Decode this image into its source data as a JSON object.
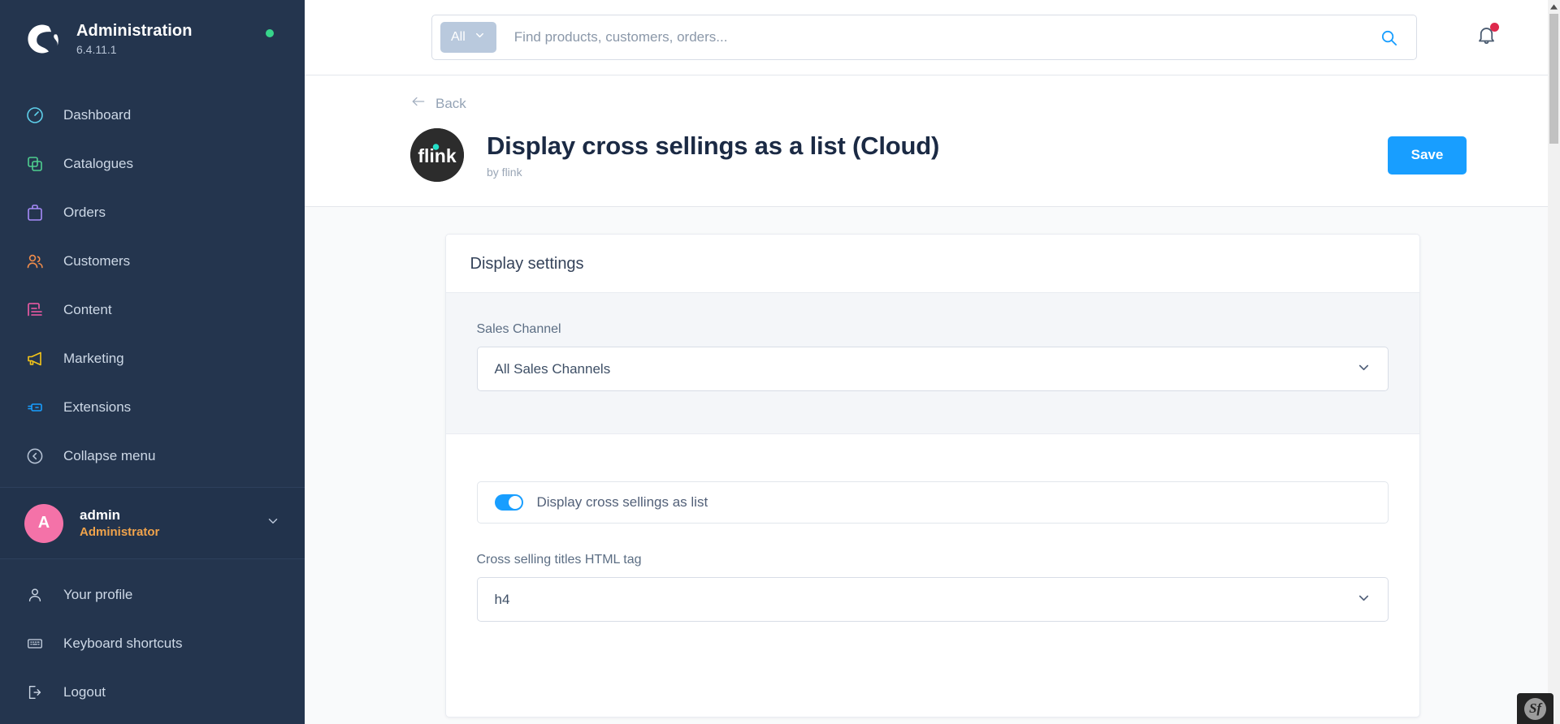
{
  "sidebar": {
    "brand": {
      "title": "Administration",
      "version": "6.4.11.1",
      "logo_icon": "shopware-logo-icon",
      "status_icon": "status-online-dot"
    },
    "items": [
      {
        "label": "Dashboard",
        "icon": "dashboard-icon",
        "color": "#5ecfea"
      },
      {
        "label": "Catalogues",
        "icon": "catalogues-icon",
        "color": "#4ecf8f"
      },
      {
        "label": "Orders",
        "icon": "orders-icon",
        "color": "#a78bfa"
      },
      {
        "label": "Customers",
        "icon": "customers-icon",
        "color": "#f08c4b"
      },
      {
        "label": "Content",
        "icon": "content-icon",
        "color": "#f35ba7"
      },
      {
        "label": "Marketing",
        "icon": "marketing-icon",
        "color": "#f5c518"
      },
      {
        "label": "Extensions",
        "icon": "extensions-icon",
        "color": "#189eff"
      },
      {
        "label": "Collapse menu",
        "icon": "collapse-menu-icon",
        "color": "#b9c6d8"
      }
    ],
    "user": {
      "initial": "A",
      "name": "admin",
      "role": "Administrator",
      "avatar_color": "#f472a8",
      "role_color": "#f0a34b",
      "chevron_icon": "chevron-down-icon"
    },
    "bottom_items": [
      {
        "label": "Your profile",
        "icon": "user-icon"
      },
      {
        "label": "Keyboard shortcuts",
        "icon": "keyboard-icon"
      },
      {
        "label": "Logout",
        "icon": "logout-icon"
      }
    ]
  },
  "topbar": {
    "search": {
      "scope_label": "All",
      "scope_chevron_icon": "chevron-down-icon",
      "placeholder": "Find products, customers, orders...",
      "value": "",
      "search_icon": "search-icon"
    },
    "notifications": {
      "icon": "bell-icon",
      "has_unread": true,
      "dot_color": "#de294c"
    }
  },
  "page_header": {
    "back_label": "Back",
    "back_icon": "arrow-left-icon",
    "extension_logo": {
      "icon": "flink-logo-icon",
      "wordmark": "flink",
      "bg_color": "#2c2c2c",
      "accent_color": "#25e0c8"
    },
    "title": "Display cross sellings as a list (Cloud)",
    "byline": "by flink",
    "save_label": "Save",
    "save_color": "#189eff"
  },
  "card": {
    "title": "Display settings",
    "sales_channel": {
      "label": "Sales Channel",
      "value": "All Sales Channels",
      "chevron_icon": "chevron-down-icon"
    },
    "toggle": {
      "label": "Display cross sellings as list",
      "enabled": true,
      "on_color": "#189eff"
    },
    "html_tag": {
      "label": "Cross selling titles HTML tag",
      "value": "h4",
      "chevron_icon": "chevron-down-icon"
    }
  },
  "scrollbar": {
    "up_arrow_icon": "caret-up-icon",
    "down_arrow_icon": "caret-down-icon"
  },
  "debug_toolbar": {
    "label": "Sf",
    "name": "symfony-profiler-toolbar"
  }
}
